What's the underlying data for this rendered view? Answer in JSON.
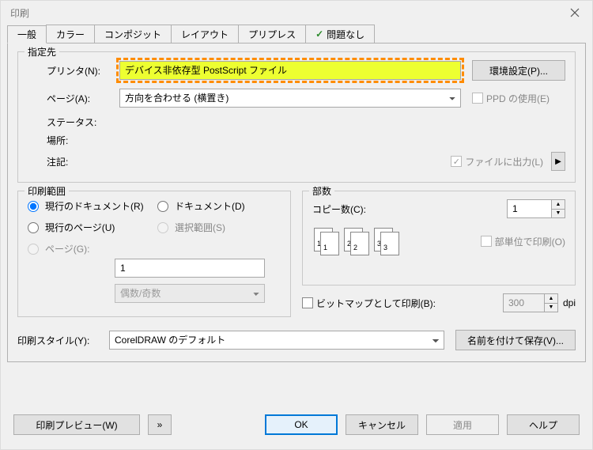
{
  "title": "印刷",
  "tabs": [
    {
      "label": "一般"
    },
    {
      "label": "カラー"
    },
    {
      "label": "コンポジット"
    },
    {
      "label": "レイアウト"
    },
    {
      "label": "プリプレス"
    },
    {
      "label": "問題なし"
    }
  ],
  "destination": {
    "legend": "指定先",
    "printer_label": "プリンタ(N):",
    "printer_value": "デバイス非依存型 PostScript ファイル",
    "settings_btn": "環境設定(P)...",
    "page_label": "ページ(A):",
    "page_value": "方向を合わせる (横置き)",
    "use_ppd": "PPD の使用(E)",
    "status_label": "ステータス:",
    "location_label": "場所:",
    "comment_label": "注記:",
    "print_to_file": "ファイルに出力(L)"
  },
  "range": {
    "legend": "印刷範囲",
    "opt_current_doc": "現行のドキュメント(R)",
    "opt_document": "ドキュメント(D)",
    "opt_current_page": "現行のページ(U)",
    "opt_selection": "選択範囲(S)",
    "opt_pages": "ページ(G):",
    "pages_value": "1",
    "evenodd": "偶数/奇数"
  },
  "copies": {
    "legend": "部数",
    "count_label": "コピー数(C):",
    "count_value": "1",
    "collate_label": "部単位で印刷(O)",
    "bitmap_label": "ビットマップとして印刷(B):",
    "dpi_value": "300",
    "dpi_unit": "dpi"
  },
  "style": {
    "label": "印刷スタイル(Y):",
    "value": "CorelDRAW のデフォルト",
    "saveas_btn": "名前を付けて保存(V)..."
  },
  "buttons": {
    "preview": "印刷プレビュー(W)",
    "ok": "OK",
    "cancel": "キャンセル",
    "apply": "適用",
    "help": "ヘルプ"
  }
}
